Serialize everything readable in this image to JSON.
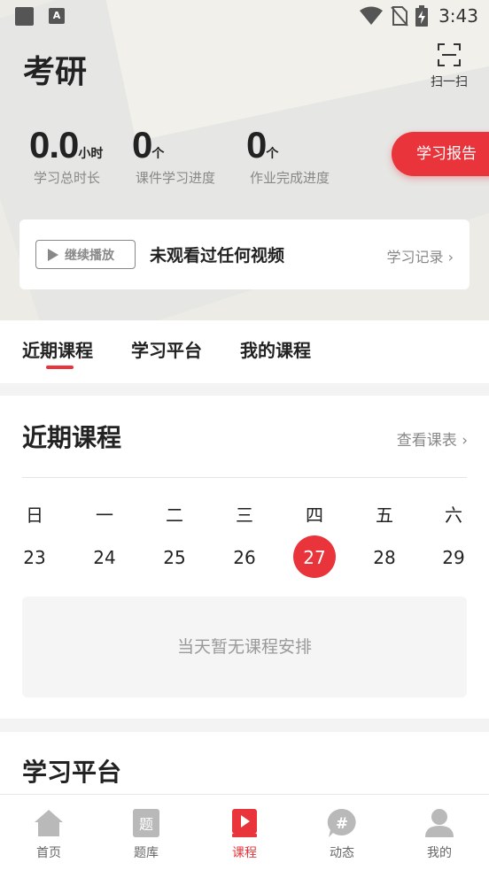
{
  "status_bar": {
    "time": "3:43",
    "icons": [
      "notification-square-icon",
      "a-keyboard-icon",
      "wifi-icon",
      "no-sim-icon",
      "battery-charging-icon"
    ]
  },
  "header": {
    "title": "考研",
    "scan_label": "扫一扫"
  },
  "stats": [
    {
      "value": "0.0",
      "unit": "小时",
      "label": "学习总时长"
    },
    {
      "value": "0",
      "unit": "个",
      "label": "课件学习进度"
    },
    {
      "value": "0",
      "unit": "个",
      "label": "作业完成进度"
    }
  ],
  "report_button": "学习报告",
  "play_card": {
    "continue_label": "继续播放",
    "message": "未观看过任何视频",
    "history_link": "学习记录"
  },
  "tabs": [
    {
      "label": "近期课程",
      "active": true
    },
    {
      "label": "学习平台",
      "active": false
    },
    {
      "label": "我的课程",
      "active": false
    }
  ],
  "recent": {
    "title": "近期课程",
    "view_table": "查看课表",
    "weekdays": [
      "日",
      "一",
      "二",
      "三",
      "四",
      "五",
      "六"
    ],
    "days": [
      "23",
      "24",
      "25",
      "26",
      "27",
      "28",
      "29"
    ],
    "selected_day": "27",
    "empty_text": "当天暂无课程安排"
  },
  "platform": {
    "title": "学习平台"
  },
  "bottom_nav": [
    {
      "label": "首页",
      "icon": "home-icon",
      "active": false
    },
    {
      "label": "题库",
      "icon": "question-bank-icon",
      "active": false
    },
    {
      "label": "课程",
      "icon": "course-icon",
      "active": true
    },
    {
      "label": "动态",
      "icon": "hashtag-chat-icon",
      "active": false
    },
    {
      "label": "我的",
      "icon": "profile-icon",
      "active": false
    }
  ],
  "colors": {
    "accent": "#e8343a",
    "text_primary": "#222222",
    "text_secondary": "#888888"
  }
}
